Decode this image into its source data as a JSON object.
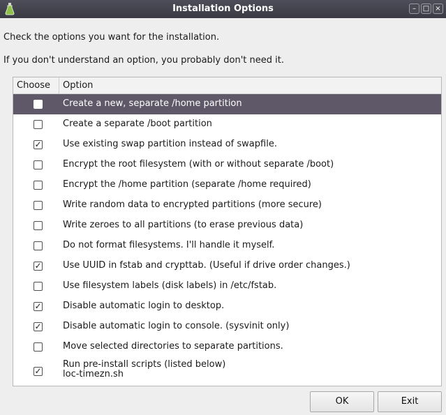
{
  "window": {
    "title": "Installation Options"
  },
  "description": {
    "line1": "Check the options you want for the installation.",
    "line2": "If you don't understand an option, you probably don't need it."
  },
  "list": {
    "columns": [
      "Choose",
      "Option"
    ],
    "rows": [
      {
        "label": "Create a new, separate /home partition",
        "checked": false,
        "selected": true
      },
      {
        "label": "Create a separate /boot partition",
        "checked": false
      },
      {
        "label": "Use existing swap partition instead of swapfile.",
        "checked": true
      },
      {
        "label": "Encrypt the root filesystem (with or without separate /boot)",
        "checked": false
      },
      {
        "label": "Encrypt the /home partition (separate /home required)",
        "checked": false
      },
      {
        "label": "Write random data to encrypted partitions (more secure)",
        "checked": false
      },
      {
        "label": "Write zeroes to all partitions (to erase previous data)",
        "checked": false
      },
      {
        "label": "Do not format filesystems. I'll handle it myself.",
        "checked": false
      },
      {
        "label": "Use UUID in fstab and crypttab. (Useful if drive order changes.)",
        "checked": true
      },
      {
        "label": "Use filesystem labels (disk labels) in /etc/fstab.",
        "checked": false
      },
      {
        "label": "Disable automatic login to desktop.",
        "checked": true
      },
      {
        "label": "Disable automatic login to console. (sysvinit only)",
        "checked": true
      },
      {
        "label": "Move selected directories to separate partitions.",
        "checked": false
      },
      {
        "label": "Run pre-install scripts (listed below)",
        "sublabel": "loc-timezn.sh",
        "checked": true
      }
    ]
  },
  "buttons": {
    "ok": "OK",
    "exit": "Exit"
  },
  "colors": {
    "titlebar": "#3a3a44",
    "selection": "#5e5869"
  },
  "icons": {
    "app": "flask-icon",
    "minimize": "minimize-icon",
    "maximize": "maximize-icon",
    "close": "close-icon"
  }
}
